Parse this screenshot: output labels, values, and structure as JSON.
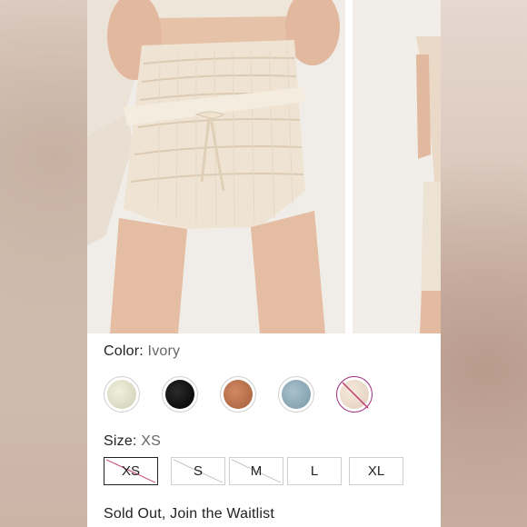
{
  "product": {
    "color_label": "Color:",
    "color_value": "Ivory",
    "swatches": [
      {
        "name": "ivory",
        "selected": false,
        "unavailable": false
      },
      {
        "name": "black",
        "selected": false,
        "unavailable": false
      },
      {
        "name": "rust",
        "selected": false,
        "unavailable": false
      },
      {
        "name": "dusty-blue",
        "selected": false,
        "unavailable": false
      },
      {
        "name": "cream",
        "selected": true,
        "unavailable": true
      }
    ],
    "size_label": "Size:",
    "size_value": "XS",
    "sizes": [
      {
        "label": "XS",
        "selected": true,
        "unavailable": true
      },
      {
        "label": "S",
        "selected": false,
        "unavailable": true
      },
      {
        "label": "M",
        "selected": false,
        "unavailable": true
      },
      {
        "label": "L",
        "selected": false,
        "unavailable": false
      },
      {
        "label": "XL",
        "selected": false,
        "unavailable": false
      }
    ],
    "status_text": "Sold Out, Join the Waitlist"
  },
  "colors": {
    "selected_swatch_ring": "#9a2c78",
    "unavailable_slash": "#c0396b",
    "text": "#222222",
    "muted_text": "#666666"
  }
}
